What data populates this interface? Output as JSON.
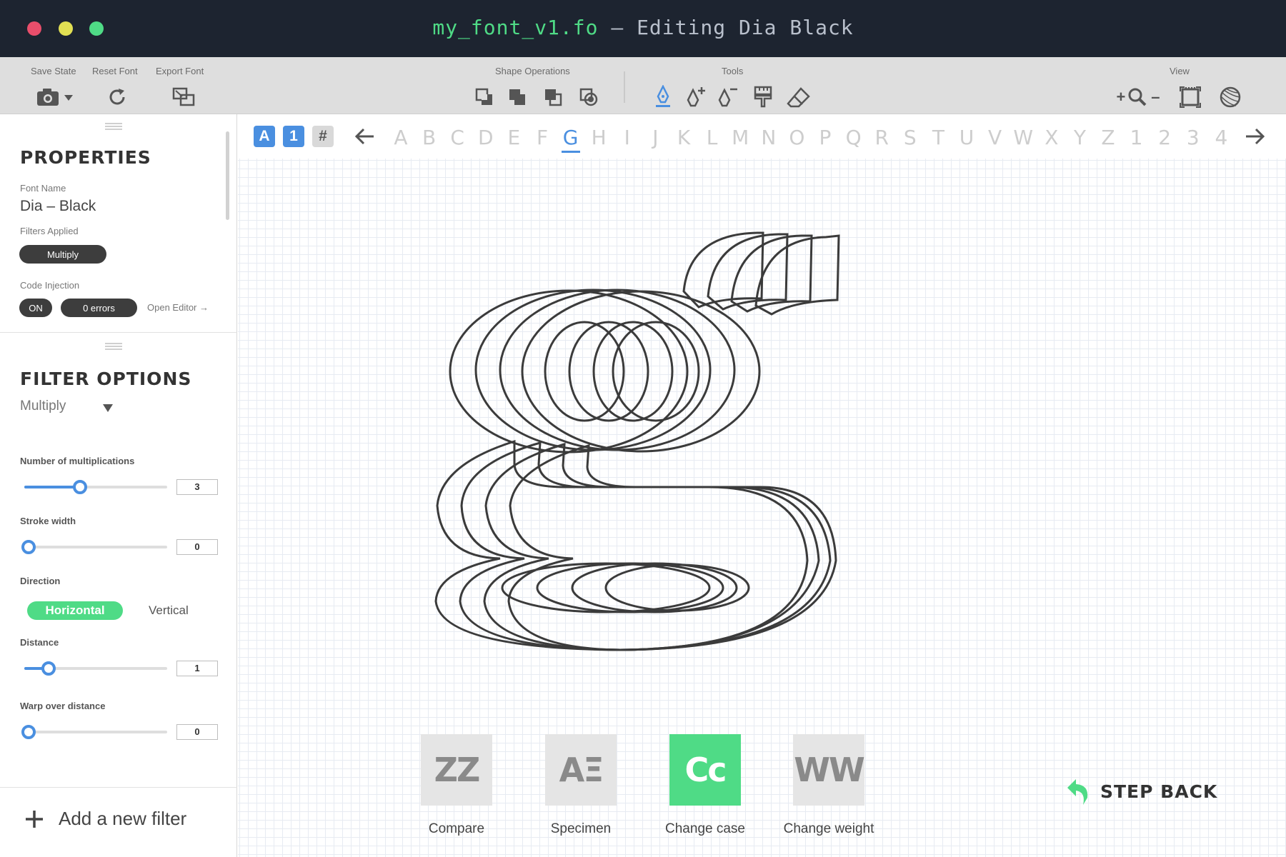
{
  "window": {
    "filename": "my_font_v1.fo",
    "separator": "–",
    "editing": "Editing Dia Black",
    "traffic_colors": [
      "#e94e6b",
      "#e2e053",
      "#4fdb86"
    ]
  },
  "toolbar": {
    "save_state": "Save State",
    "reset_font": "Reset Font",
    "export_font": "Export Font",
    "shape_operations": "Shape Operations",
    "tools": "Tools",
    "view": "View",
    "zoom_in": "+",
    "zoom_out": "–"
  },
  "properties": {
    "title": "PROPERTIES",
    "font_name_label": "Font Name",
    "font_name": "Dia – Black",
    "filters_applied_label": "Filters Applied",
    "filter_pill": "Multiply",
    "code_injection_label": "Code Injection",
    "code_on": "ON",
    "code_errors": "0 errors",
    "open_editor": "Open Editor →"
  },
  "filter_options": {
    "title": "FILTER OPTIONS",
    "selected_filter": "Multiply",
    "multiplications_label": "Number of multiplications",
    "multiplications_value": "3",
    "multiplications_fraction": 0.36,
    "stroke_label": "Stroke width",
    "stroke_value": "0",
    "stroke_fraction": 0,
    "direction_label": "Direction",
    "direction_horizontal": "Horizontal",
    "direction_vertical": "Vertical",
    "distance_label": "Distance",
    "distance_value": "1",
    "distance_fraction": 0.14,
    "warp_label": "Warp over distance",
    "warp_value": "0",
    "warp_fraction": 0,
    "add_filter": "Add a new filter"
  },
  "glyph_bar": {
    "modes": [
      "A",
      "1",
      "#"
    ],
    "letters": [
      "A",
      "B",
      "C",
      "D",
      "E",
      "F",
      "G",
      "H",
      "I",
      "J",
      "K",
      "L",
      "M",
      "N",
      "O",
      "P",
      "Q",
      "R",
      "S",
      "T",
      "U",
      "V",
      "W",
      "X",
      "Y",
      "Z",
      "1",
      "2",
      "3",
      "4"
    ],
    "active_letter": "G"
  },
  "actions": {
    "compare": "Compare",
    "compare_glyph": "ZZ",
    "specimen": "Specimen",
    "specimen_glyph": "AΞ",
    "change_case": "Change case",
    "change_case_glyph": "Cc",
    "change_weight": "Change weight",
    "change_weight_glyph": "WW",
    "step_back": "STEP BACK"
  },
  "colors": {
    "accent_blue": "#4a8fe0",
    "accent_green": "#4fdb86",
    "titlebar": "#1d2430"
  }
}
